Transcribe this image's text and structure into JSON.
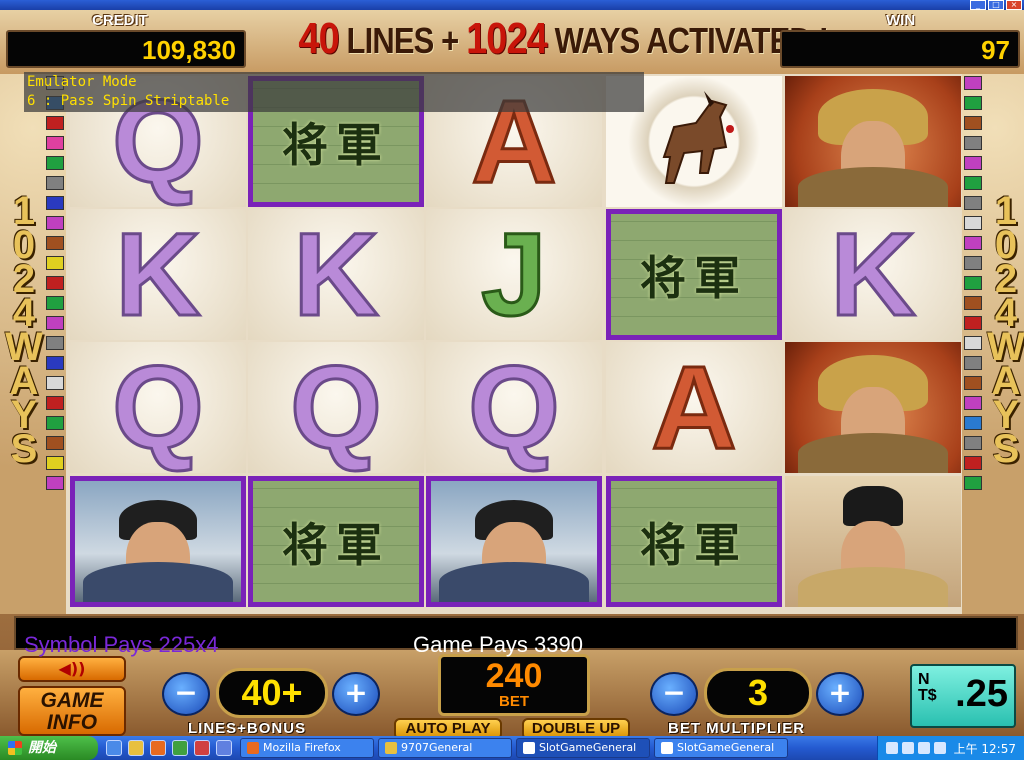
{
  "window": {
    "title": ""
  },
  "header": {
    "credit_label": "CREDIT",
    "credit_value": "109,830",
    "banner_parts": [
      "40",
      " LINES + ",
      "1024",
      " WAYS ACTIVATED !"
    ],
    "win_label": "WIN",
    "win_value": "97"
  },
  "emulator": {
    "line1": "Emulator Mode",
    "line2": "6 : Pass Spin Striptable"
  },
  "sides": {
    "ways_text": "1024WAYS"
  },
  "reels": [
    [
      "Q",
      "K",
      "Q",
      "portrait-blue"
    ],
    [
      "general",
      "K",
      "Q",
      "general"
    ],
    [
      "A",
      "J",
      "Q",
      "portrait-blue"
    ],
    [
      "horse",
      "general",
      "A",
      "general"
    ],
    [
      "portrait-red",
      "K",
      "portrait-red",
      "portrait-official"
    ]
  ],
  "winning_cells": [
    [
      1,
      0
    ],
    [
      3,
      1
    ],
    [
      0,
      3
    ],
    [
      1,
      3
    ],
    [
      2,
      3
    ],
    [
      3,
      3
    ]
  ],
  "reel_symbols": {
    "general": {
      "glyphs": "将軍"
    }
  },
  "messages": {
    "symbol_pays": "Symbol Pays 225x4",
    "game_pays": "Game Pays 3390"
  },
  "controls": {
    "sound_icon": "speaker-icon",
    "game_info_line1": "GAME",
    "game_info_line2": "INFO",
    "minus_symbol": "−",
    "plus_symbol": "+",
    "lines_value": "40+",
    "lines_label": "LINES+BONUS",
    "bet_value": "240",
    "bet_label": "BET",
    "auto_play": "AUTO PLAY",
    "double_up": "DOUBLE UP",
    "multiplier_value": "3",
    "multiplier_label": "BET MULTIPLIER",
    "denom_currency": "NT$",
    "denom_value": ".25"
  },
  "taskbar": {
    "start_label": "開始",
    "tasks": [
      "Mozilla Firefox",
      "9707General",
      "SlotGameGeneral",
      "SlotGameGeneral"
    ],
    "clock": "上午 12:57"
  },
  "colors": {
    "winning_frame": "#7a22b8",
    "meter_digits": "#ffd200",
    "symbol_pays": "#7a28d8",
    "bet_text": "#ff8a00",
    "denom_bg": "#2ac0b0"
  },
  "indicator_colors_left": [
    "#d8d8d8",
    "#2a7ad0",
    "#c02020",
    "#e040a0",
    "#20a040",
    "#808080",
    "#2a3ac0",
    "#c040c0",
    "#a05020",
    "#e0d020",
    "#c02020",
    "#20a040",
    "#c040c0",
    "#808080",
    "#2a3ac0",
    "#d8d8d8",
    "#c02020",
    "#20a040",
    "#a05020",
    "#e0d020",
    "#c040c0",
    "#2a7ad0",
    "#20a040",
    "#808080",
    "#a05020",
    "#20a040",
    "#c02020",
    "#d8d8d8"
  ],
  "indicator_colors_right": [
    "#c040c0",
    "#20a040",
    "#a05020",
    "#808080",
    "#c040c0",
    "#20a040",
    "#808080",
    "#d8d8d8",
    "#c040c0",
    "#808080",
    "#20a040",
    "#a05020",
    "#c02020",
    "#d8d8d8",
    "#808080",
    "#a05020",
    "#c040c0",
    "#2a7ad0",
    "#808080",
    "#c02020",
    "#20a040",
    "#c040c0",
    "#808080",
    "#20a040",
    "#a05020",
    "#c040c0",
    "#808080",
    "#d8d8d8"
  ]
}
